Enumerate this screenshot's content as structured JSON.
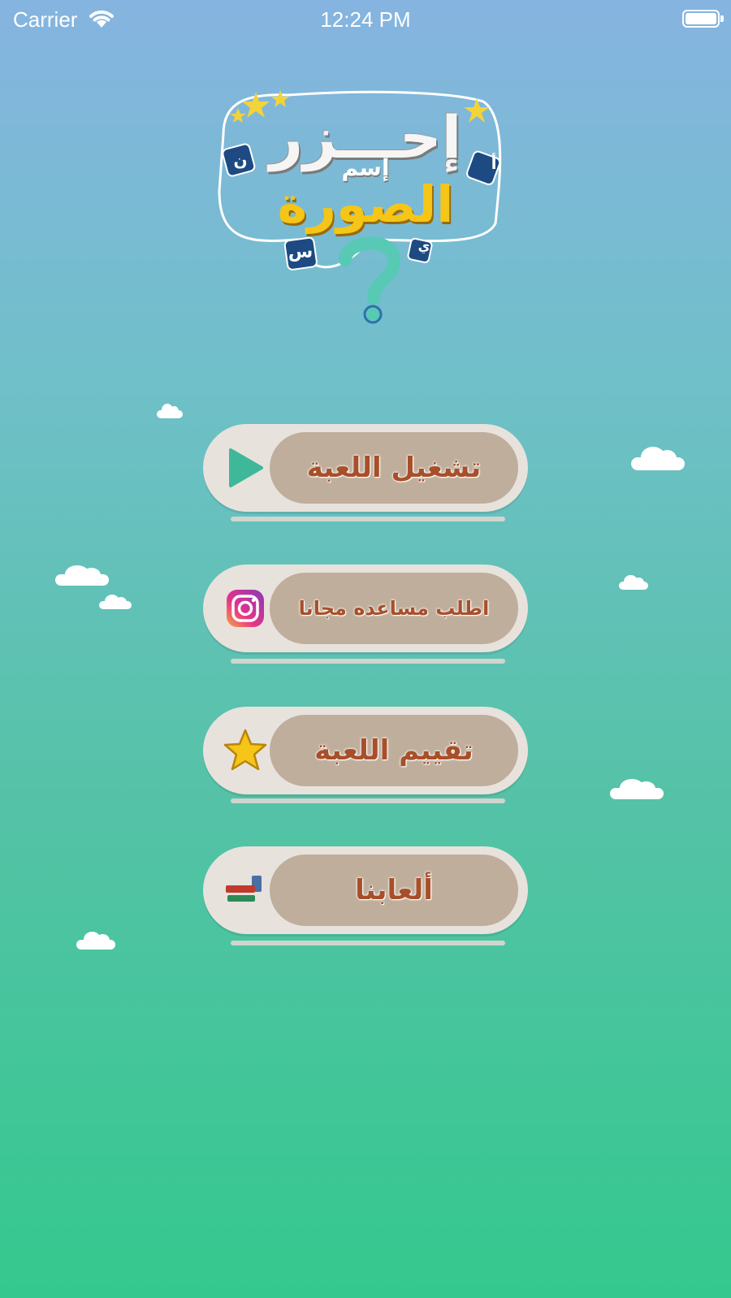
{
  "status_bar": {
    "carrier": "Carrier",
    "time": "12:24 PM"
  },
  "logo": {
    "line1": "إحـــزر",
    "line2": "إسم",
    "line3": "الصورة",
    "letters": [
      "ن",
      "أ",
      "س",
      "ي"
    ],
    "mark": "?"
  },
  "menu": {
    "play": {
      "label": "تشغيل اللعبة",
      "icon": "play-icon"
    },
    "help": {
      "label": "اطلب مساعده مجانا",
      "icon": "instagram-icon"
    },
    "rate": {
      "label": "تقييم اللعبة",
      "icon": "star-icon"
    },
    "games": {
      "label": "ألعابنا",
      "icon": "our-games-logo"
    }
  },
  "colors": {
    "button_outer": "#e8e2dd",
    "button_inner": "#bfae9b",
    "label": "#a84f2a",
    "play_icon": "#3fb89a"
  }
}
